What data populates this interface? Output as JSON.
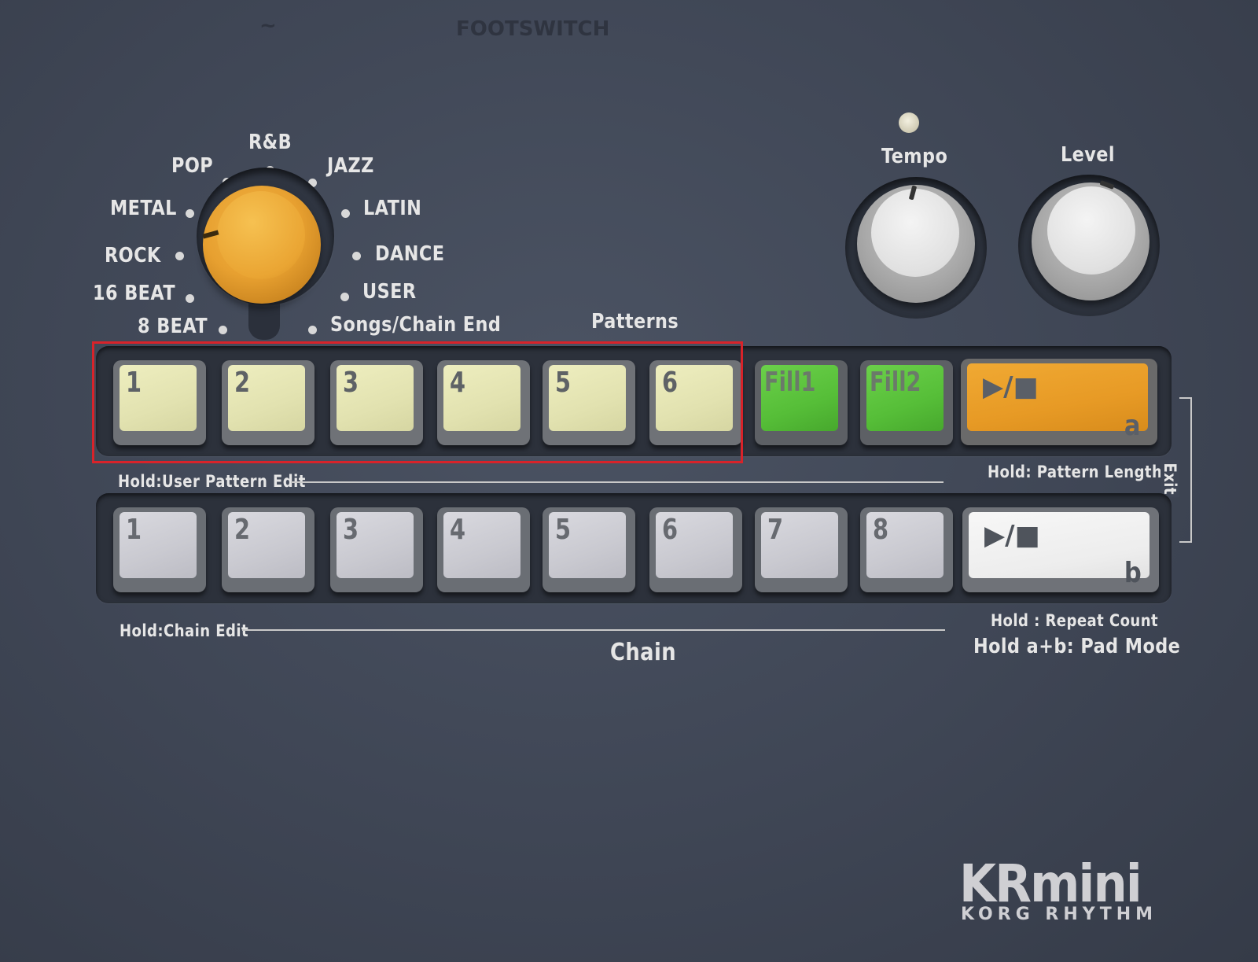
{
  "top_faint": [
    "FOOTSWITCH"
  ],
  "genres": {
    "rnb": "R&B",
    "pop": "POP",
    "jazz": "JAZZ",
    "metal": "METAL",
    "latin": "LATIN",
    "rock": "ROCK",
    "dance": "DANCE",
    "beat16": "16 BEAT",
    "user": "USER",
    "beat8": "8 BEAT",
    "songs": "Songs/Chain End"
  },
  "knobs": {
    "tempo": "Tempo",
    "level": "Level"
  },
  "patterns_label": "Patterns",
  "pattern_pads": [
    "1",
    "2",
    "3",
    "4",
    "5",
    "6"
  ],
  "fill_pads": [
    "Fill1",
    "Fill2"
  ],
  "start_stop_icon": "▶/■",
  "start_a_letter": "a",
  "start_b_letter": "b",
  "hold_user_pattern_edit": "Hold:User Pattern Edit",
  "hold_pattern_length": "Hold: Pattern Length",
  "exit_label": "Exit",
  "chain_pads": [
    "1",
    "2",
    "3",
    "4",
    "5",
    "6",
    "7",
    "8"
  ],
  "hold_chain_edit": "Hold:Chain Edit",
  "hold_repeat_count": "Hold : Repeat Count",
  "hold_pad_mode": "Hold a+b: Pad Mode",
  "chain_label": "Chain",
  "logo": {
    "main": "KRmini",
    "sub": "KORG RHYTHM"
  },
  "colors": {
    "panel": "#3f4655",
    "pattern_pad": "#e2e2b0",
    "fill_pad": "#56be38",
    "start_a": "#e79a25",
    "start_b": "#ededed",
    "chain_pad": "#c9c9d0",
    "selector_knob": "#e7a030",
    "highlight": "#d8232a"
  },
  "icons": {
    "start_stop": "play-stop-icon"
  }
}
